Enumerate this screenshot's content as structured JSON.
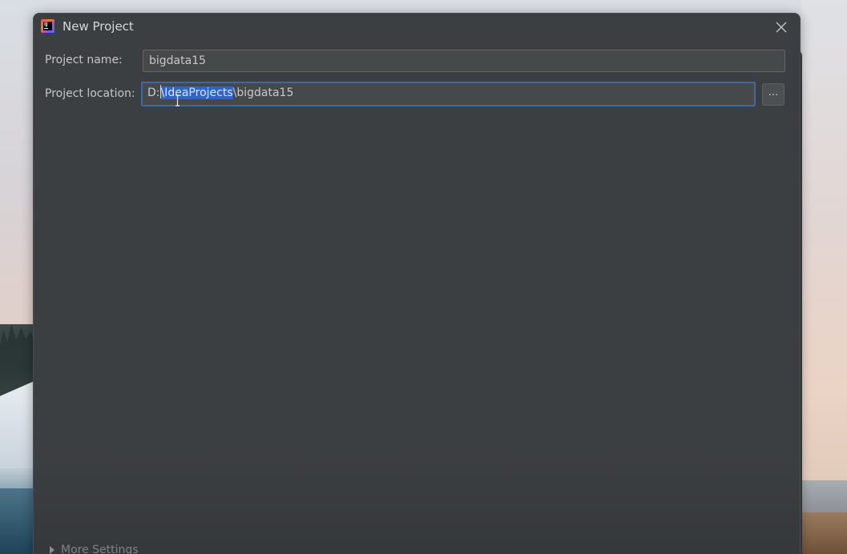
{
  "dialog": {
    "title": "New Project"
  },
  "form": {
    "project_name": {
      "label": "Project name:",
      "value": "bigdata15"
    },
    "project_location": {
      "label": "Project location:",
      "value_prefix": "D:",
      "value_selected": "\\IdeaProjects",
      "value_suffix": "\\bigdata15",
      "browse_label": "..."
    }
  },
  "more_settings": {
    "label": "More Settings"
  },
  "icons": {
    "app": "intellij-idea-icon",
    "close": "close-icon",
    "expand": "triangle-right-icon",
    "cursor": "text-cursor-icon"
  },
  "colors": {
    "dialog_bg": "#3c3f41",
    "field_bg": "#45494a",
    "focus_border": "#3d6aa6",
    "selection": "#2f65ca"
  }
}
